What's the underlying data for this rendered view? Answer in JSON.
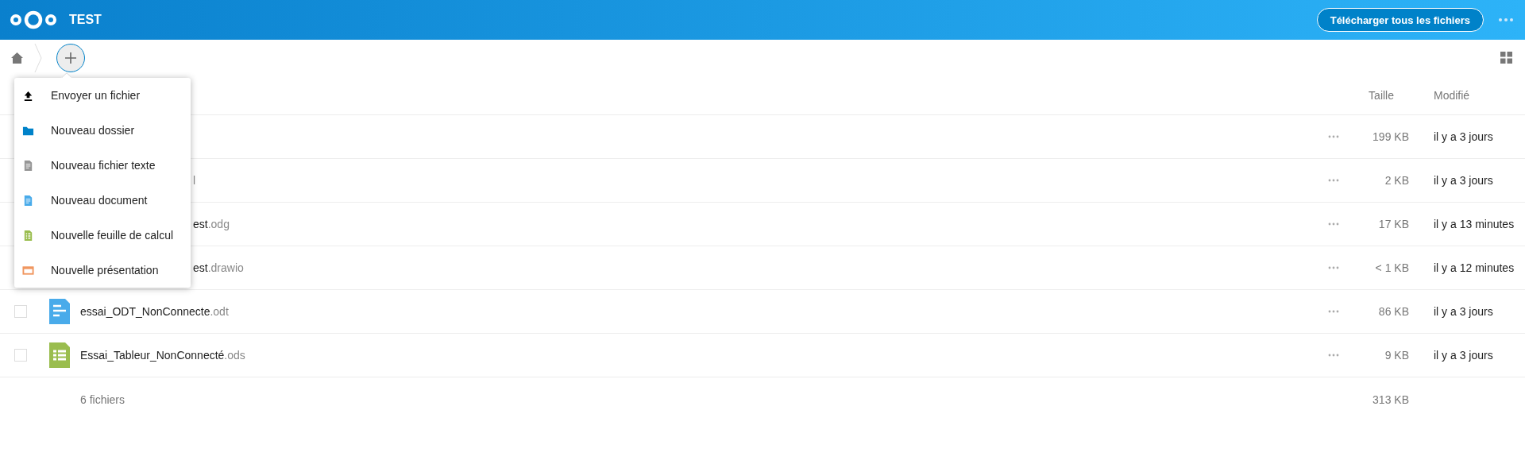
{
  "header": {
    "title": "TEST",
    "download_button": "Télécharger tous les fichiers"
  },
  "new_menu": {
    "items": [
      {
        "kind": "upload",
        "label": "Envoyer un fichier"
      },
      {
        "kind": "folder",
        "label": "Nouveau dossier"
      },
      {
        "kind": "text",
        "label": "Nouveau fichier texte"
      },
      {
        "kind": "document",
        "label": "Nouveau document"
      },
      {
        "kind": "spreadsheet",
        "label": "Nouvelle feuille de calcul"
      },
      {
        "kind": "presentation",
        "label": "Nouvelle présentation"
      }
    ]
  },
  "table": {
    "columns": [
      "Taille",
      "Modifié"
    ],
    "rows": [
      {
        "size": "199 KB",
        "modified": "il y a 3 jours"
      },
      {
        "name": "l",
        "size": "2 KB",
        "modified": "il y a 3 jours"
      },
      {
        "name": "est",
        "extension": ".odg",
        "size": "17 KB",
        "modified": "il y a 13 minutes"
      },
      {
        "name": "est",
        "extension": ".drawio",
        "size": "< 1 KB",
        "modified": "il y a 12 minutes"
      },
      {
        "checked": false,
        "kind": "document",
        "name": "essai_ODT_NonConnecte",
        "extension": ".odt",
        "size": "86 KB",
        "modified": "il y a 3 jours"
      },
      {
        "checked": false,
        "kind": "spreadsheet",
        "name": "Essai_Tableur_NonConnecté",
        "extension": ".ods",
        "size": "9 KB",
        "modified": "il y a 3 jours"
      }
    ],
    "footer": {
      "count": "6 fichiers",
      "total": "313 KB"
    }
  }
}
